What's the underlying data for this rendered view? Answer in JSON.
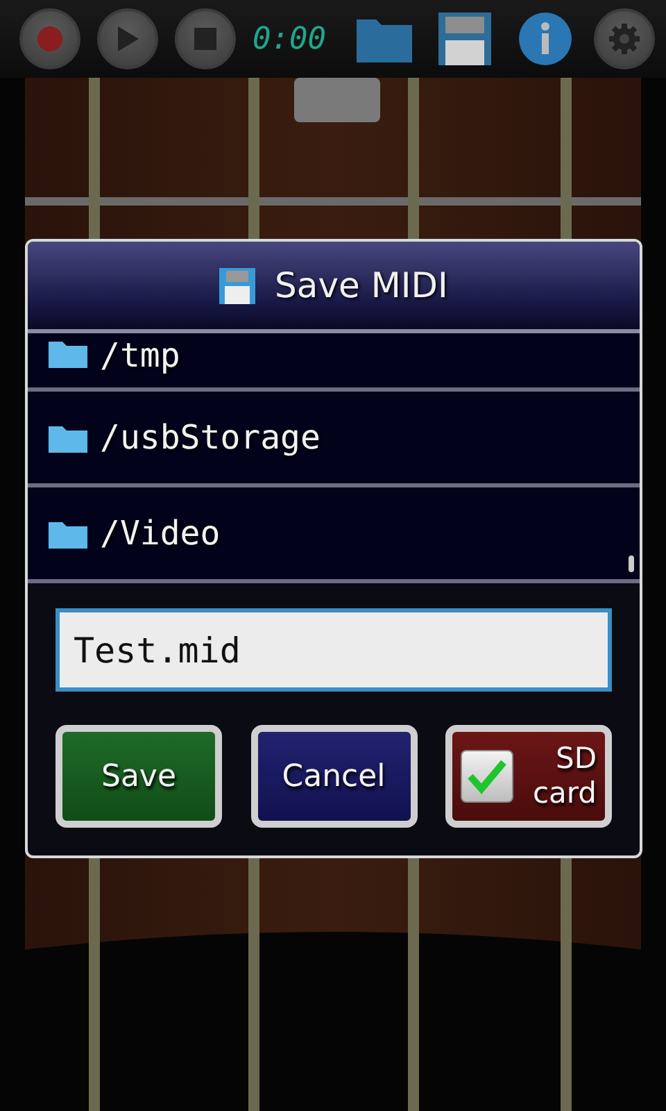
{
  "toolbar": {
    "timer": "0:00"
  },
  "dialog": {
    "title": "Save MIDI",
    "folders": [
      {
        "name": "/tmp",
        "partial": true
      },
      {
        "name": "/usbStorage",
        "partial": false
      },
      {
        "name": "/Video",
        "partial": false
      }
    ],
    "filename": {
      "value": "Test.mid"
    },
    "buttons": [
      {
        "kind": "save",
        "label": "Save"
      },
      {
        "kind": "cancel",
        "label": "Cancel"
      },
      {
        "kind": "toggle",
        "label": "SD card",
        "checked": true
      }
    ]
  }
}
